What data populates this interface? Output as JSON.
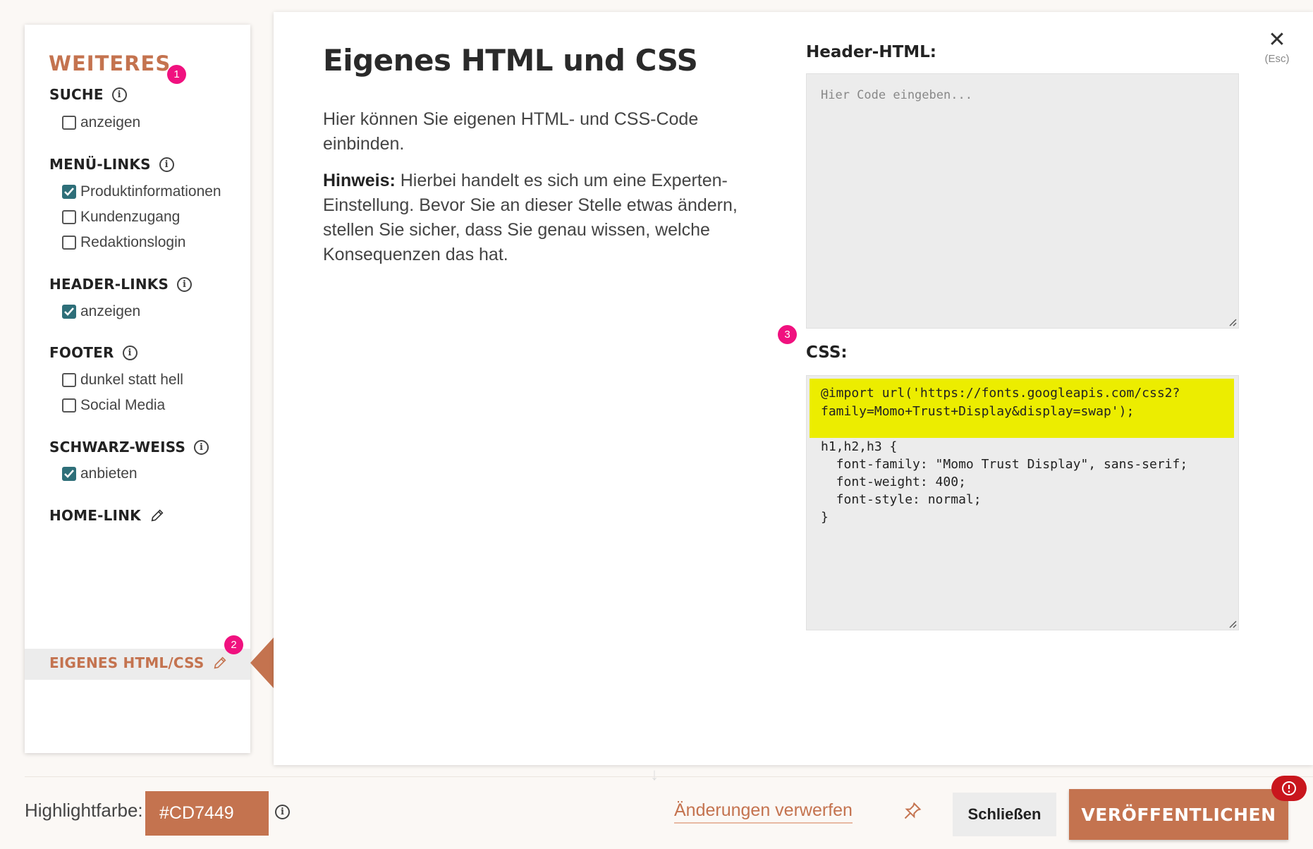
{
  "sidebar": {
    "title": "WEITERES",
    "title_badge": "1",
    "sections": {
      "suche": {
        "heading": "SUCHE",
        "options": [
          {
            "label": "anzeigen",
            "checked": false
          }
        ]
      },
      "menu_links": {
        "heading": "MENÜ-LINKS",
        "options": [
          {
            "label": "Produktinformationen",
            "checked": true
          },
          {
            "label": "Kundenzugang",
            "checked": false
          },
          {
            "label": "Redaktionslogin",
            "checked": false
          }
        ]
      },
      "header_links": {
        "heading": "HEADER-LINKS",
        "options": [
          {
            "label": "anzeigen",
            "checked": true
          }
        ]
      },
      "footer": {
        "heading": "FOOTER",
        "options": [
          {
            "label": "dunkel statt hell",
            "checked": false
          },
          {
            "label": "Social Media",
            "checked": false
          }
        ]
      },
      "schwarz_weiss": {
        "heading": "SCHWARZ-WEISS",
        "options": [
          {
            "label": "anbieten",
            "checked": true
          }
        ]
      },
      "home_link": {
        "heading": "HOME-LINK"
      },
      "eigenes_html_css": {
        "heading": "EIGENES HTML/CSS",
        "badge": "2",
        "active": true
      }
    }
  },
  "panel": {
    "title": "Eigenes HTML und CSS",
    "description": "Hier können Sie eigenen HTML- und CSS-Code einbinden.",
    "note_label": "Hinweis:",
    "note_text": " Hierbei handelt es sich um eine Experten-Einstellung. Bevor Sie an dieser Stelle etwas ändern, stellen Sie sicher, dass Sie genau wissen, welche Konsequenzen das hat.",
    "close_label": "(Esc)",
    "header_html": {
      "label": "Header-HTML:",
      "placeholder": "Hier Code eingeben...",
      "value": ""
    },
    "css": {
      "label": "CSS:",
      "badge": "3",
      "lines": [
        "@import url('https://fonts.googleapis.com/css2?",
        "family=Momo+Trust+Display&display=swap');",
        "",
        "h1,h2,h3 {",
        "  font-family: \"Momo Trust Display\", sans-serif;",
        "  font-weight: 400;",
        "  font-style: normal;",
        "}"
      ]
    }
  },
  "footer": {
    "highlight_label": "Highlightfarbe:",
    "highlight_value": "#CD7449",
    "discard_label": "Änderungen verwerfen",
    "close_button": "Schließen",
    "publish_button": "VERÖFFENTLICHEN",
    "alert_icon": "exclamation-circle-icon"
  },
  "colors": {
    "accent": "#c4734f",
    "badge": "#f0117f",
    "checkbox": "#2e6f79",
    "code_highlight": "#eced00",
    "alert": "#c9161d"
  }
}
